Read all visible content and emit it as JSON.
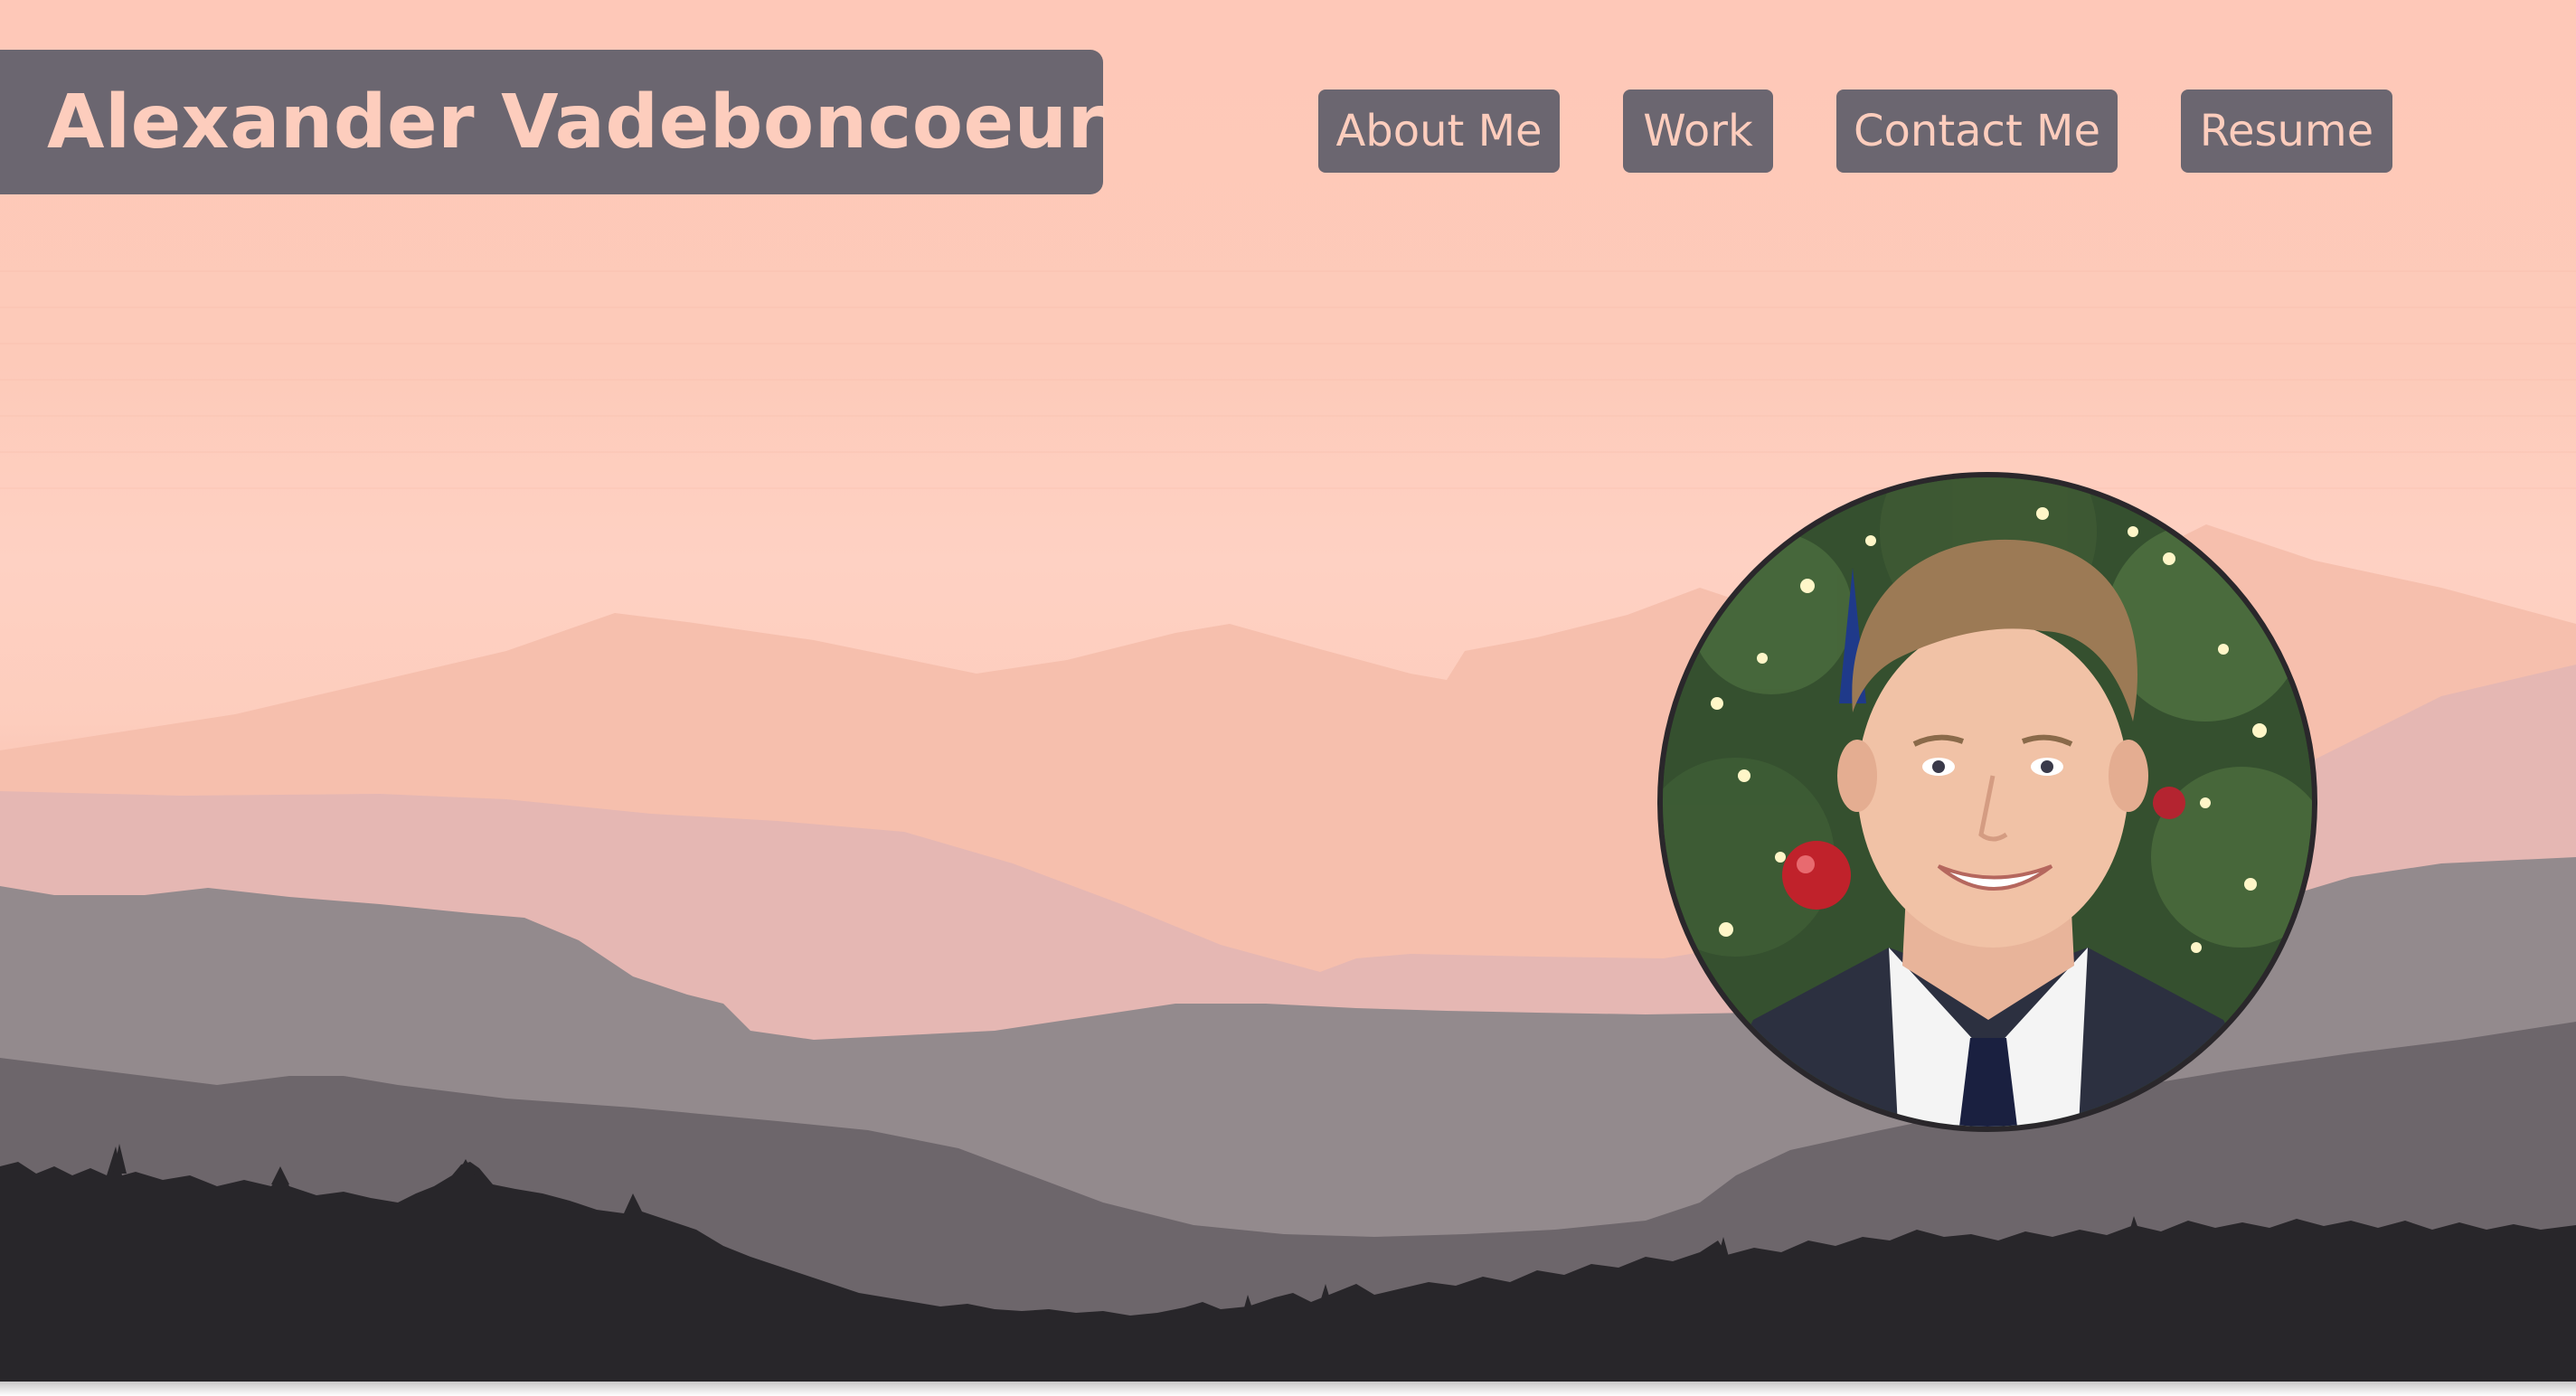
{
  "header": {
    "site_name": "Alexander Vadeboncoeur"
  },
  "nav": {
    "items": [
      {
        "label": "About Me"
      },
      {
        "label": "Work"
      },
      {
        "label": "Contact Me"
      },
      {
        "label": "Resume"
      }
    ]
  },
  "profile": {
    "photo_description_icon": "profile-photo"
  },
  "colors": {
    "accent_box": "#6b6670",
    "accent_text": "#fdcdbd",
    "sky": "#fdcab9",
    "forest": "#28262a"
  }
}
